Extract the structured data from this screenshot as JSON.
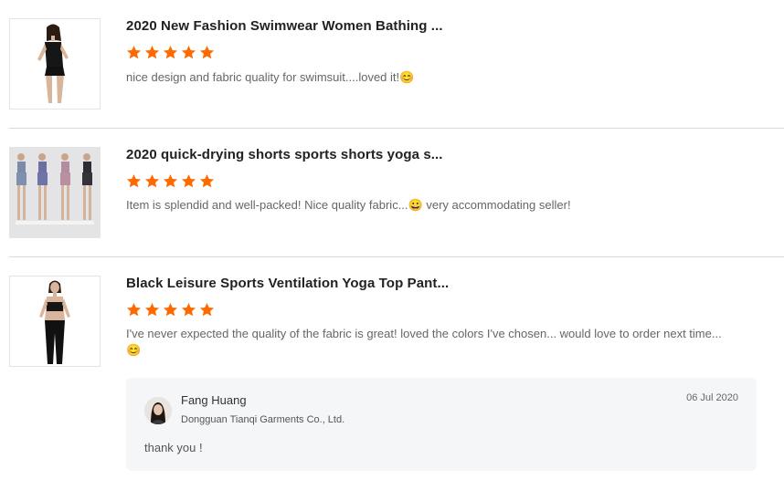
{
  "reviews": [
    {
      "product_title": "2020 New Fashion Swimwear Women Bathing ...",
      "rating": 5,
      "comment": "nice design and fabric quality for swimsuit....loved it!😊"
    },
    {
      "product_title": "2020 quick-drying shorts sports shorts yoga s...",
      "rating": 5,
      "comment": "Item is splendid and well-packed! Nice quality fabric...😀 very accommodating seller!"
    },
    {
      "product_title": "Black Leisure Sports Ventilation Yoga Top Pant...",
      "rating": 5,
      "comment": "I've never expected the quality of the fabric is great! loved the colors I've chosen... would love to order next time...😊"
    }
  ],
  "reply": {
    "seller_name": "Fang Huang",
    "company": "Dongguan Tianqi Garments Co., Ltd.",
    "date": "06 Jul 2020",
    "text": "thank you !"
  },
  "colors": {
    "star": "#ff6a00",
    "divider": "#d9d9d9",
    "reply_background": "#f5f6f8"
  },
  "icons": {
    "rating": "star-icon"
  }
}
